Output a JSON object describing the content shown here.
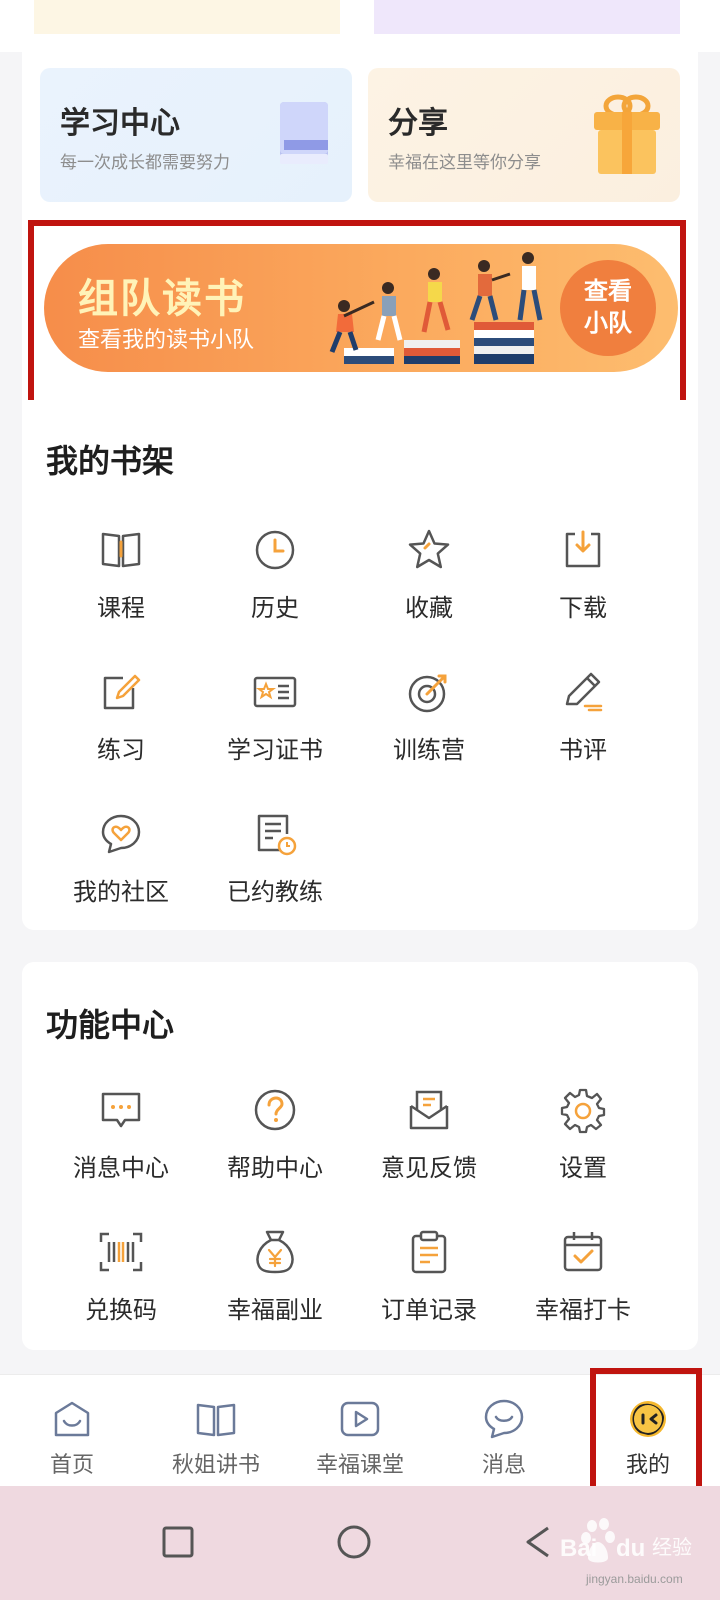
{
  "cards": {
    "study": {
      "title": "学习中心",
      "subtitle": "每一次成长都需要努力"
    },
    "share": {
      "title": "分享",
      "subtitle": "幸福在这里等你分享"
    }
  },
  "banner": {
    "title": "组队读书",
    "subtitle": "查看我的读书小队",
    "button_line1": "查看",
    "button_line2": "小队"
  },
  "shelf": {
    "title": "我的书架",
    "items": [
      {
        "label": "课程",
        "icon": "book-open-icon"
      },
      {
        "label": "历史",
        "icon": "clock-icon"
      },
      {
        "label": "收藏",
        "icon": "star-icon"
      },
      {
        "label": "下载",
        "icon": "download-icon"
      },
      {
        "label": "练习",
        "icon": "edit-icon"
      },
      {
        "label": "学习证书",
        "icon": "certificate-icon"
      },
      {
        "label": "训练营",
        "icon": "target-icon"
      },
      {
        "label": "书评",
        "icon": "pen-icon"
      },
      {
        "label": "我的社区",
        "icon": "heart-chat-icon"
      },
      {
        "label": "已约教练",
        "icon": "schedule-doc-icon"
      }
    ]
  },
  "functions": {
    "title": "功能中心",
    "items": [
      {
        "label": "消息中心",
        "icon": "message-icon"
      },
      {
        "label": "帮助中心",
        "icon": "help-icon"
      },
      {
        "label": "意见反馈",
        "icon": "feedback-mail-icon"
      },
      {
        "label": "设置",
        "icon": "gear-icon"
      },
      {
        "label": "兑换码",
        "icon": "barcode-icon"
      },
      {
        "label": "幸福副业",
        "icon": "money-bag-icon"
      },
      {
        "label": "订单记录",
        "icon": "clipboard-icon"
      },
      {
        "label": "幸福打卡",
        "icon": "calendar-check-icon"
      }
    ]
  },
  "nav": {
    "items": [
      {
        "label": "首页",
        "icon": "home-smile-icon"
      },
      {
        "label": "秋姐讲书",
        "icon": "book-icon"
      },
      {
        "label": "幸福课堂",
        "icon": "play-icon"
      },
      {
        "label": "消息",
        "icon": "chat-bubble-icon"
      },
      {
        "label": "我的",
        "icon": "profile-face-icon"
      }
    ],
    "active_index": 4
  },
  "colors": {
    "accent": "#f5a23b",
    "icon_stroke": "#555555",
    "highlight_border": "#c0140f",
    "banner_orange": "#f68d4a"
  },
  "watermark": {
    "brand": "Bai du 经验",
    "url": "jingyan.baidu.com"
  }
}
